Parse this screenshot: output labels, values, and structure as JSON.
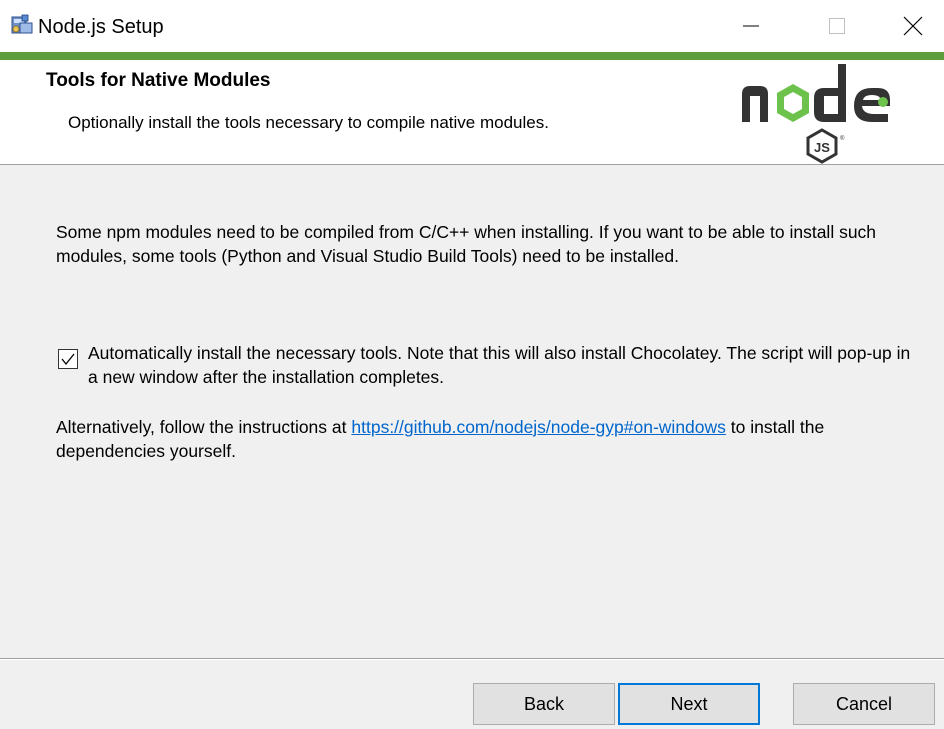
{
  "window": {
    "title": "Node.js Setup",
    "accent_color": "#5c9c3d"
  },
  "banner": {
    "title": "Tools for Native Modules",
    "subtitle": "Optionally install the tools necessary to compile native modules.",
    "logo_icon": "nodejs-logo"
  },
  "body": {
    "description": "Some npm modules need to be compiled from C/C++ when installing. If you want to be able to install such modules, some tools (Python and Visual Studio Build Tools) need to be installed.",
    "checkbox": {
      "checked": true,
      "label": "Automatically install the necessary tools. Note that this will also install Chocolatey. The script will pop-up in a new window after the installation completes."
    },
    "alternative": {
      "prefix": "Alternatively, follow the instructions at ",
      "link_text": "https://github.com/nodejs/node-gyp#on-windows",
      "suffix": " to install the dependencies yourself."
    }
  },
  "footer": {
    "back_label": "Back",
    "next_label": "Next",
    "cancel_label": "Cancel"
  }
}
